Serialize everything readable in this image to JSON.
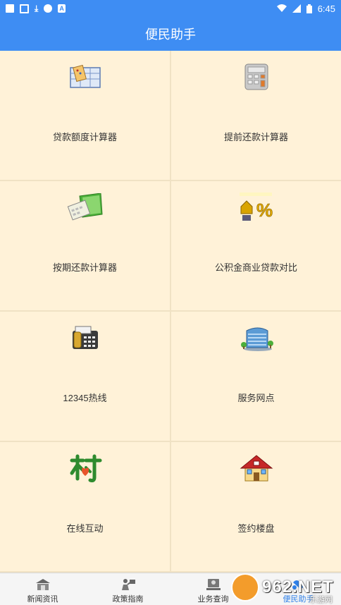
{
  "status_bar": {
    "time": "6:45",
    "notif_glyph_1": "⤓",
    "notif_glyph_2": "A"
  },
  "app_bar": {
    "title": "便民助手"
  },
  "tiles": [
    {
      "label": "贷款额度计算器",
      "icon": "calculator-sheet-icon"
    },
    {
      "label": "提前还款计算器",
      "icon": "calculator-icon"
    },
    {
      "label": "按期还款计算器",
      "icon": "calculator-folder-icon"
    },
    {
      "label": "公积金商业贷款对比",
      "icon": "house-percent-icon"
    },
    {
      "label": "12345热线",
      "icon": "fax-phone-icon"
    },
    {
      "label": "服务网点",
      "icon": "building-icon"
    },
    {
      "label": "在线互动",
      "icon": "interaction-logo-icon"
    },
    {
      "label": "签约楼盘",
      "icon": "house-icon"
    }
  ],
  "tab_bar": {
    "tabs": [
      {
        "label": "新闻资讯",
        "icon": "news-icon"
      },
      {
        "label": "政策指南",
        "icon": "policy-icon"
      },
      {
        "label": "业务查询",
        "icon": "query-icon"
      },
      {
        "label": "便民助手",
        "icon": "helper-icon",
        "active": true
      }
    ]
  },
  "watermark": {
    "text": "962.NET",
    "sub": "乐游网"
  },
  "colors": {
    "primary": "#3e8df3",
    "tile_bg": "#fff2d8",
    "active_tab": "#2f80e8"
  }
}
